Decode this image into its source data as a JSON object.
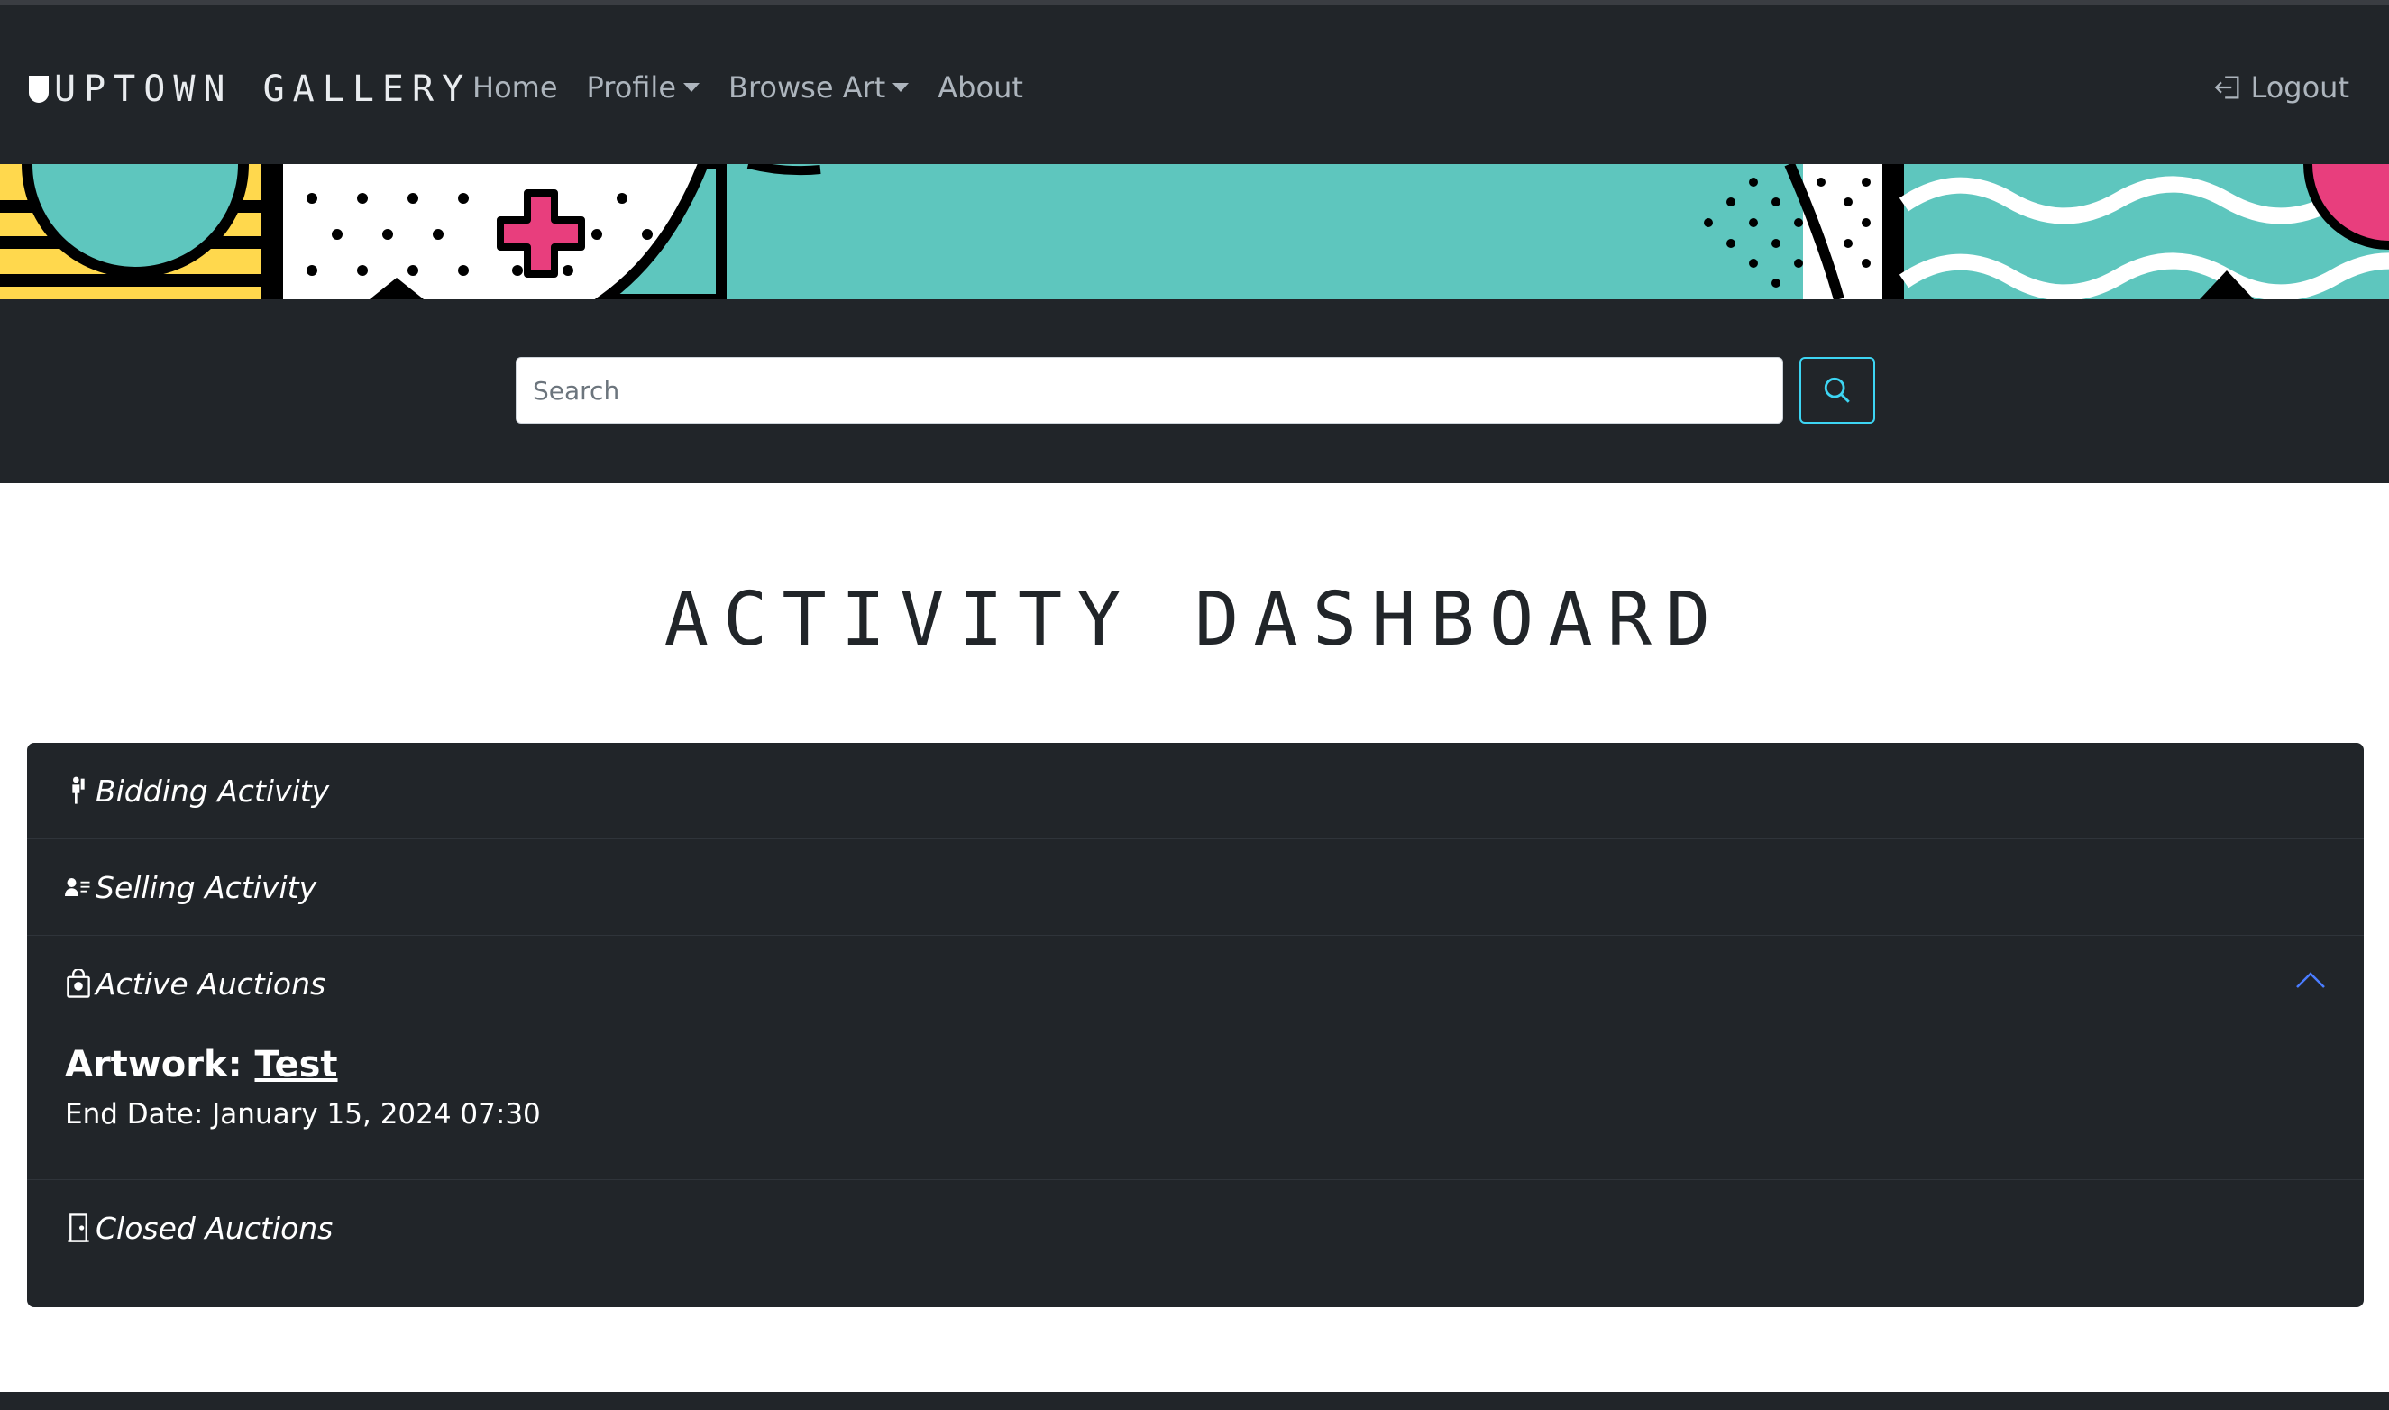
{
  "brand": "UPTOWN GALLERY",
  "nav": {
    "home": "Home",
    "profile": "Profile",
    "browse_art": "Browse Art",
    "about": "About",
    "logout": "Logout"
  },
  "search": {
    "placeholder": "Search"
  },
  "page_title": "ACTIVITY DASHBOARD",
  "accordion": {
    "items": [
      {
        "label": "Bidding Activity",
        "icon": "bidder-icon"
      },
      {
        "label": "Selling Activity",
        "icon": "seller-icon"
      },
      {
        "label": "Active Auctions",
        "icon": "bag-icon"
      },
      {
        "label": "Closed Auctions",
        "icon": "door-icon"
      }
    ],
    "active_auction": {
      "artwork_label": "Artwork:",
      "artwork_title": "Test",
      "end_date": "End Date: January 15, 2024 07:30"
    }
  },
  "colors": {
    "navbar": "#212529",
    "banner_teal": "#5ec6be",
    "banner_pink": "#e83e7d",
    "banner_yellow": "#ffd84d",
    "search_btn_border": "#3dd5f3",
    "chevron": "#4a7cff"
  }
}
